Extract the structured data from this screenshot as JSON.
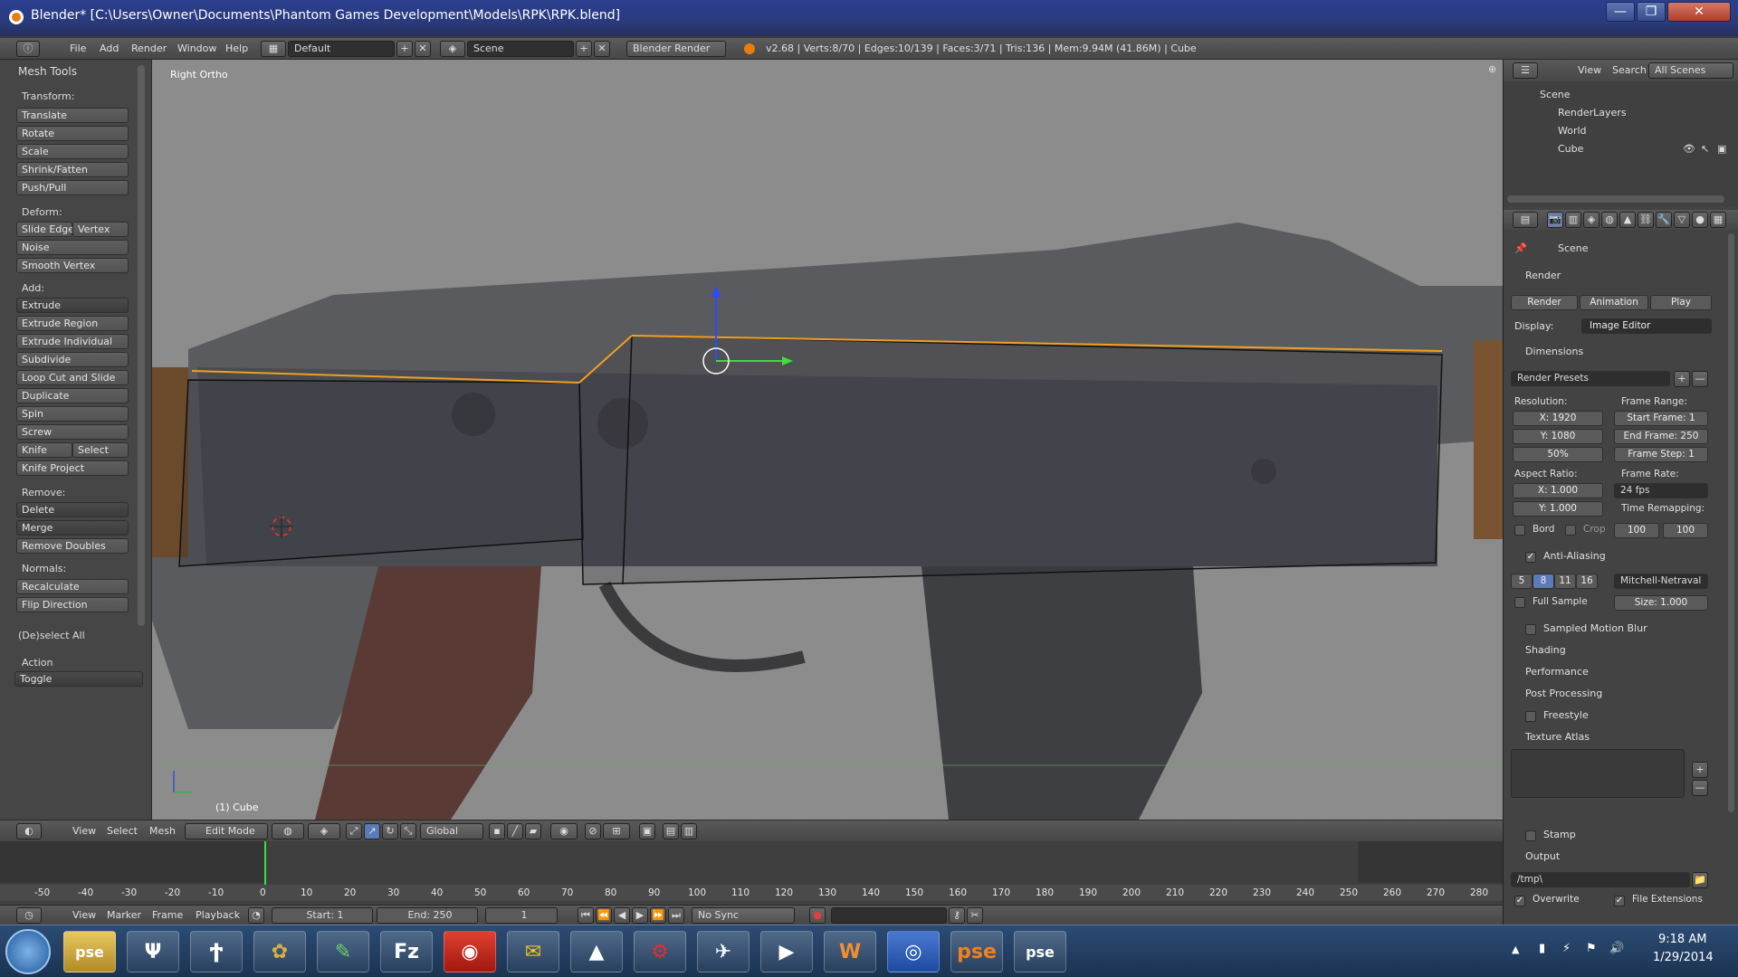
{
  "window": {
    "title": "Blender* [C:\\Users\\Owner\\Documents\\Phantom Games Development\\Models\\RPK\\RPK.blend]"
  },
  "menu": {
    "items": [
      "File",
      "Add",
      "Render",
      "Window",
      "Help"
    ],
    "layout": "Default",
    "scene": "Scene",
    "engine": "Blender Render",
    "stats": "v2.68 | Verts:8/70 | Edges:10/139 | Faces:3/71 | Tris:136 | Mem:9.94M (41.86M) | Cube"
  },
  "tools": {
    "panel_title": "Mesh Tools",
    "transform_label": "Transform:",
    "transform": [
      "Translate",
      "Rotate",
      "Scale",
      "Shrink/Fatten",
      "Push/Pull"
    ],
    "deform_label": "Deform:",
    "slide_edge": "Slide Edge",
    "vertex": "Vertex",
    "noise": "Noise",
    "smooth_vertex": "Smooth Vertex",
    "add_label": "Add:",
    "extrude": "Extrude",
    "add": [
      "Extrude Region",
      "Extrude Individual",
      "Subdivide",
      "Loop Cut and Slide",
      "Duplicate",
      "Spin",
      "Screw"
    ],
    "knife": "Knife",
    "select": "Select",
    "knife_project": "Knife Project",
    "remove_label": "Remove:",
    "delete": "Delete",
    "merge": "Merge",
    "remove_doubles": "Remove Doubles",
    "normals_label": "Normals:",
    "recalculate": "Recalculate",
    "flip_direction": "Flip Direction",
    "deselect_title": "(De)select All",
    "action_label": "Action",
    "action_value": "Toggle"
  },
  "viewport": {
    "view_name": "Right Ortho",
    "object_label": "(1) Cube"
  },
  "viewport_header": {
    "view": "View",
    "select": "Select",
    "mesh": "Mesh",
    "mode": "Edit Mode",
    "orientation": "Global"
  },
  "timeline": {
    "ticks": [
      "-50",
      "-40",
      "-30",
      "-20",
      "-10",
      "0",
      "10",
      "20",
      "30",
      "40",
      "50",
      "60",
      "70",
      "80",
      "90",
      "100",
      "110",
      "120",
      "130",
      "140",
      "150",
      "160",
      "170",
      "180",
      "190",
      "200",
      "210",
      "220",
      "230",
      "240",
      "250",
      "260",
      "270",
      "280"
    ],
    "view": "View",
    "marker": "Marker",
    "frame": "Frame",
    "playback": "Playback",
    "start": "Start: 1",
    "end": "End: 250",
    "current": "1",
    "sync": "No Sync"
  },
  "outliner": {
    "view": "View",
    "search": "Search",
    "scope": "All Scenes",
    "items": [
      "Scene",
      "RenderLayers",
      "World",
      "Cube"
    ]
  },
  "properties": {
    "scene": "Scene",
    "render_title": "Render",
    "render_btn": "Render",
    "animation_btn": "Animation",
    "play_btn": "Play",
    "display_label": "Display:",
    "display_value": "Image Editor",
    "dimensions_title": "Dimensions",
    "render_presets": "Render Presets",
    "resolution_label": "Resolution:",
    "res_x": "X: 1920",
    "res_y": "Y: 1080",
    "res_pct": "50%",
    "frame_range_label": "Frame Range:",
    "start_frame": "Start Frame: 1",
    "end_frame": "End Frame: 250",
    "frame_step": "Frame Step: 1",
    "aspect_label": "Aspect Ratio:",
    "aspect_x": "X: 1.000",
    "aspect_y": "Y: 1.000",
    "frame_rate_label": "Frame Rate:",
    "frame_rate": "24 fps",
    "time_remap_label": "Time Remapping:",
    "remap_old": "100",
    "remap_new": "100",
    "bord": "Bord",
    "crop": "Crop",
    "aa_title": "Anti-Aliasing",
    "aa_samples": [
      "5",
      "8",
      "11",
      "16"
    ],
    "aa_filter": "Mitchell-Netraval",
    "full_sample": "Full Sample",
    "size": "Size: 1.000",
    "sections": [
      "Sampled Motion Blur",
      "Shading",
      "Performance",
      "Post Processing",
      "Freestyle"
    ],
    "texture_atlas": "Texture Atlas",
    "stamp": "Stamp",
    "output_title": "Output",
    "output_path": "/tmp\\",
    "overwrite": "Overwrite",
    "file_extensions": "File Extensions"
  },
  "taskbar": {
    "apps": [
      "pse",
      "Ψ",
      "Ϯ",
      "✿",
      "✎",
      "Fz",
      "◉",
      "✉",
      "▲",
      "⚙",
      "✈",
      "▶",
      "W",
      "◎",
      "pse"
    ],
    "time": "9:18 AM",
    "date": "1/29/2014"
  }
}
